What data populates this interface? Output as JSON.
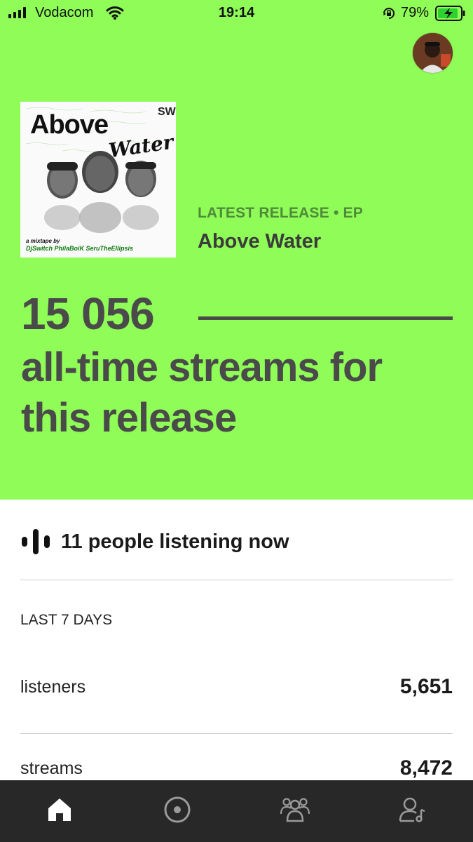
{
  "status_bar": {
    "carrier": "Vodacom",
    "time": "19:14",
    "battery": "79%",
    "icons": [
      "signal-icon",
      "wifi-icon",
      "orientation-lock-icon",
      "battery-charging-icon"
    ]
  },
  "profile": {
    "icon": "avatar"
  },
  "release": {
    "cover": {
      "title": "Above",
      "subtitle": "Water",
      "logo": "SW",
      "credit_line1": "a mixtape by",
      "credit_line2": "DjSwitch PhilaBoiK SeruTheEllipsis"
    },
    "label": "LATEST RELEASE • EP",
    "title": "Above Water"
  },
  "streams": {
    "count": "15 056",
    "caption": "all-time streams for this release"
  },
  "listening_now": {
    "text": "11 people listening now",
    "icon": "sound-bars-icon"
  },
  "stats": {
    "period": "LAST 7 DAYS",
    "rows": [
      {
        "label": "listeners",
        "value": "5,651"
      },
      {
        "label": "streams",
        "value": "8,472"
      }
    ]
  },
  "bottom_nav": {
    "items": [
      {
        "name": "home",
        "icon": "home-icon",
        "active": true
      },
      {
        "name": "music",
        "icon": "music-disc-icon",
        "active": false
      },
      {
        "name": "audience",
        "icon": "audience-icon",
        "active": false
      },
      {
        "name": "profile",
        "icon": "artist-profile-icon",
        "active": false
      }
    ]
  },
  "colors": {
    "hero_background": "#8ffc57",
    "accent_text": "#4f8a3a",
    "nav_background": "#282828"
  }
}
